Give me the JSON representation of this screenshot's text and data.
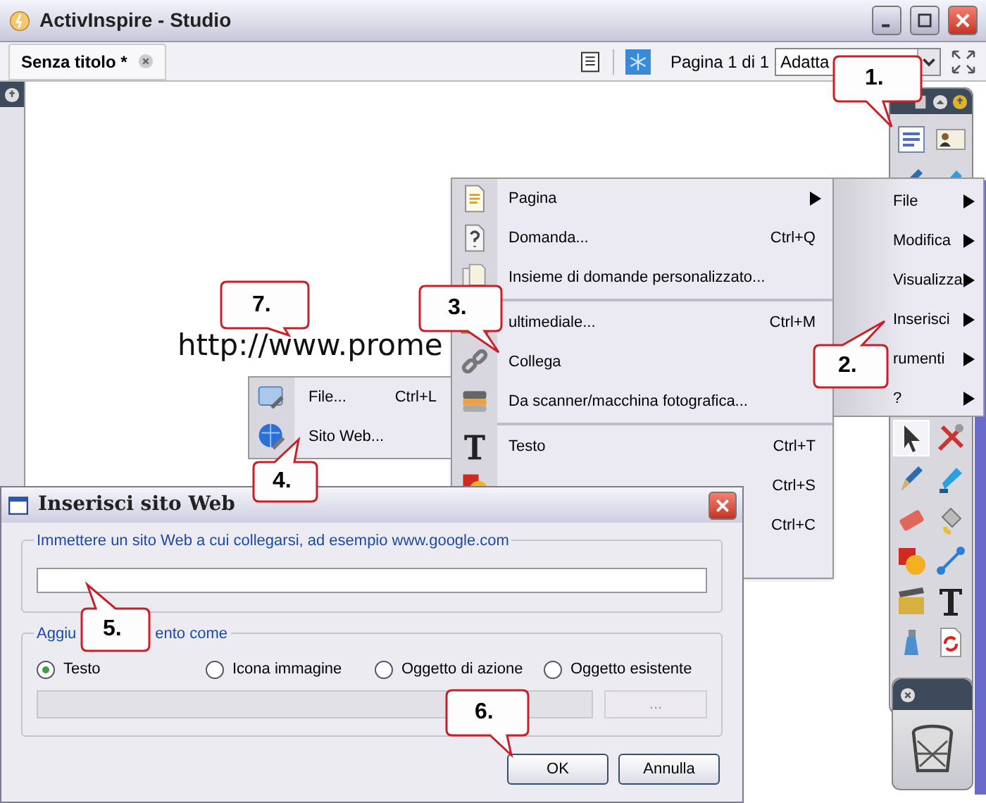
{
  "window": {
    "title": "ActivInspire - Studio"
  },
  "document_tab": {
    "label": "Senza titolo *",
    "selected": true
  },
  "page_indicator": "Pagina 1 di 1",
  "zoom_select": {
    "value": "Adatta"
  },
  "canvas_text": "http://www.prome",
  "insert_menu": [
    {
      "kind": "item",
      "label": "Pagina",
      "submenu": true
    },
    {
      "kind": "item",
      "label": "Domanda...",
      "shortcut": "Ctrl+Q"
    },
    {
      "kind": "item",
      "label": "Insieme di domande personalizzato..."
    },
    {
      "kind": "separator"
    },
    {
      "kind": "item",
      "label": "ultimediale...",
      "shortcut": "Ctrl+M"
    },
    {
      "kind": "item",
      "label": "Collega"
    },
    {
      "kind": "item",
      "label": "Da scanner/macchina fotografica..."
    },
    {
      "kind": "separator"
    },
    {
      "kind": "item",
      "label": "Testo",
      "shortcut": "Ctrl+T"
    },
    {
      "kind": "item",
      "shortcut": "Ctrl+S"
    },
    {
      "kind": "item",
      "shortcut": "Ctrl+C"
    }
  ],
  "main_menu": [
    {
      "label": "File",
      "submenu": true
    },
    {
      "label": "Modifica",
      "submenu": true
    },
    {
      "label": "Visualizza",
      "submenu": true
    },
    {
      "label": "Inserisci",
      "submenu": true
    },
    {
      "label": "rumenti",
      "submenu": true
    },
    {
      "label": "?",
      "submenu": true
    }
  ],
  "link_submenu": [
    {
      "label": "File...",
      "shortcut": "Ctrl+L"
    },
    {
      "label": "Sito Web..."
    }
  ],
  "dialog": {
    "title": "Inserisci sito Web",
    "url_group": {
      "legend": "Immettere un sito Web a cui collegarsi, ad esempio www.google.com"
    },
    "add_group": {
      "legend_parts": [
        "Aggiu",
        "ento come"
      ],
      "options": [
        {
          "label": "Testo",
          "selected": true
        },
        {
          "label": "Icona immagine",
          "selected": false
        },
        {
          "label": "Oggetto di azione",
          "selected": false
        },
        {
          "label": "Oggetto esistente",
          "selected": false
        }
      ],
      "browse_button": "...",
      "disabled": true
    },
    "buttons": [
      "OK",
      "Annulla"
    ]
  },
  "callouts": [
    "1.",
    "2.",
    "3.",
    "4.",
    "5.",
    "6.",
    "7."
  ]
}
